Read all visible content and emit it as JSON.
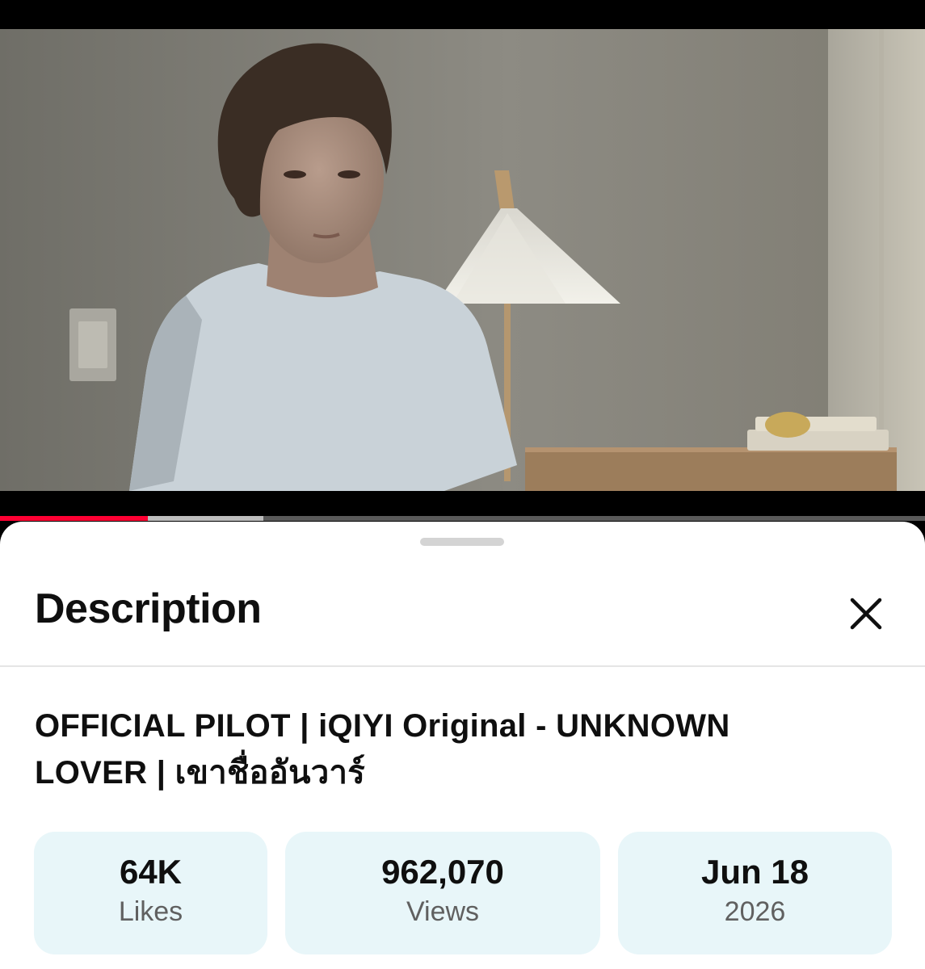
{
  "player": {
    "thumbnail_description": "",
    "progress_played": 0.16,
    "progress_buffered": 0.285,
    "played_color": "#ff0033"
  },
  "sheet": {
    "title": "Description",
    "close_icon": "close-icon"
  },
  "video": {
    "title": "OFFICIAL PILOT | iQIYI Original - UNKNOWN LOVER | เขาชื่ออันวาร์"
  },
  "stats": [
    {
      "value": "64K",
      "label": "Likes"
    },
    {
      "value": "962,070",
      "label": "Views"
    },
    {
      "value": "Jun 18",
      "label": "2026"
    }
  ],
  "colors": {
    "card_bg": "#e8f6f9",
    "accent": "#ff0033"
  }
}
